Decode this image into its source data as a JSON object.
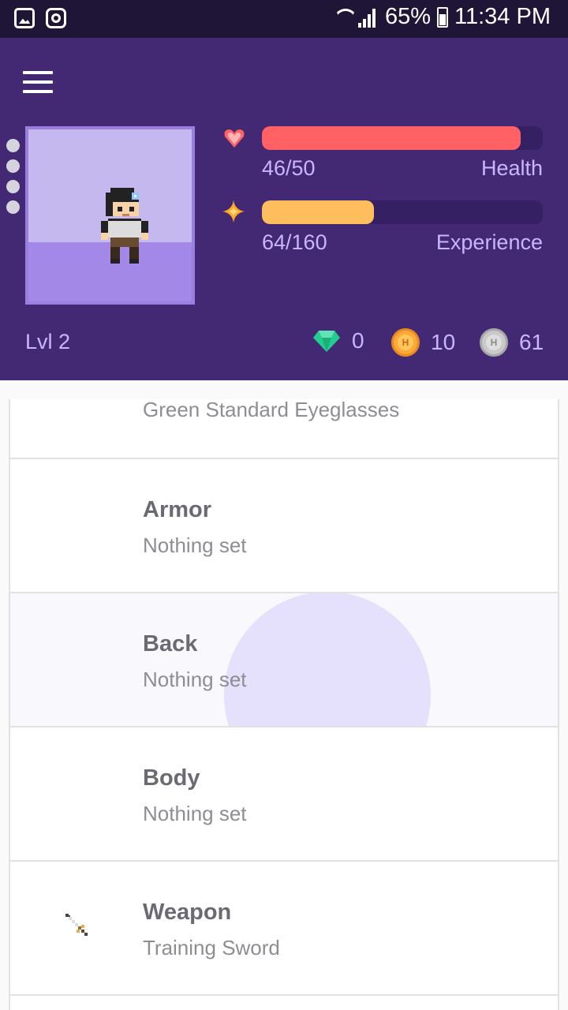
{
  "status_bar": {
    "battery": "65%",
    "time": "11:34 PM"
  },
  "header": {
    "health": {
      "value": "46/50",
      "label": "Health",
      "current": 46,
      "max": 50,
      "color": "#ff6165"
    },
    "experience": {
      "value": "64/160",
      "label": "Experience",
      "current": 64,
      "max": 160,
      "color": "#ffbe5d"
    },
    "level": "Lvl 2",
    "gems": "0",
    "gold": "10",
    "silver": "61",
    "colors": {
      "background": "#432874",
      "avatar_bg": "#c5b8ee"
    }
  },
  "equipment": [
    {
      "title": "",
      "subtitle": "Green Standard Eyeglasses"
    },
    {
      "title": "Armor",
      "subtitle": "Nothing set"
    },
    {
      "title": "Back",
      "subtitle": "Nothing set"
    },
    {
      "title": "Body",
      "subtitle": "Nothing set"
    },
    {
      "title": "Weapon",
      "subtitle": "Training Sword",
      "icon": "training-sword-icon"
    }
  ]
}
